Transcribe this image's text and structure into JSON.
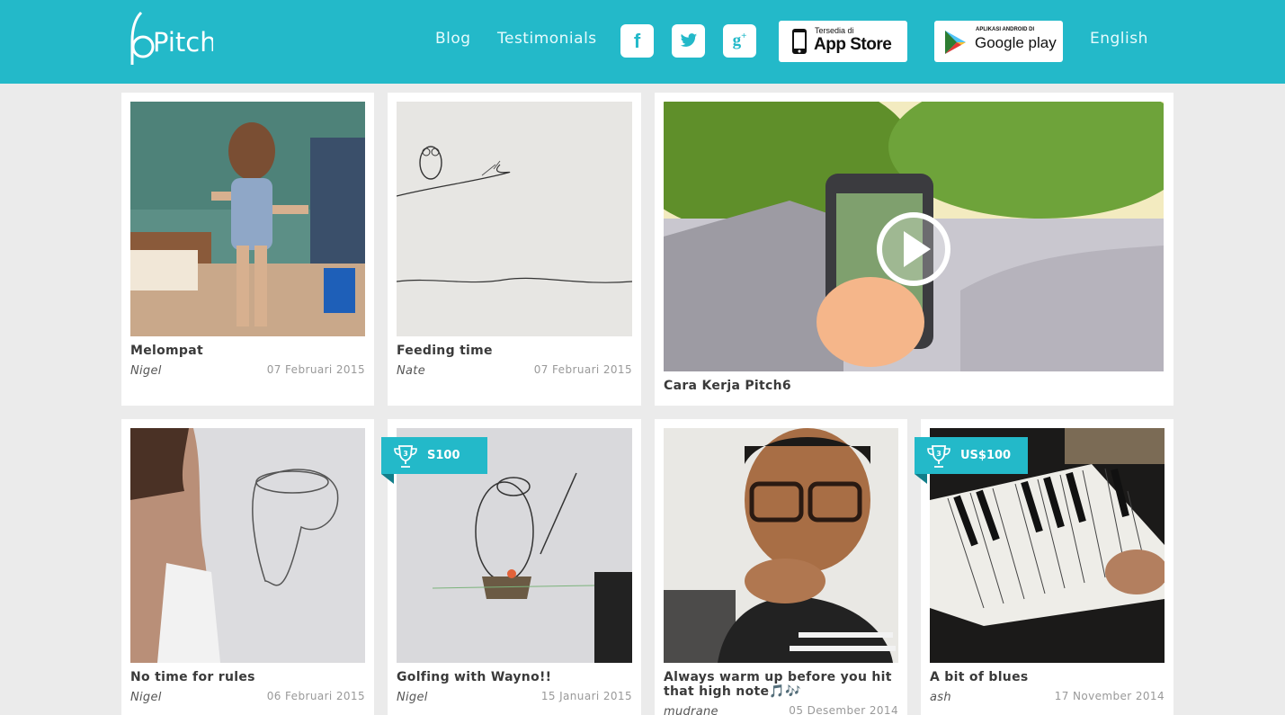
{
  "header": {
    "brand": "Pitch",
    "nav": {
      "blog": "Blog",
      "testimonials": "Testimonials",
      "language": "English"
    },
    "social": {
      "facebook_icon": "facebook-icon",
      "twitter_icon": "twitter-icon",
      "gplus_icon": "google-plus-icon"
    },
    "appstore": {
      "small": "Tersedia di",
      "big": "App Store"
    },
    "googleplay": {
      "small": "APLIKASI ANDROID DI",
      "big": "Google play"
    }
  },
  "colors": {
    "accent": "#23b9c9",
    "background": "#ebebeb",
    "card": "#ffffff"
  },
  "video": {
    "title": "Cara Kerja Pitch6",
    "play_icon": "play-icon"
  },
  "posts": [
    {
      "title": "Melompat",
      "author": "Nigel",
      "date": "07 Februari 2015"
    },
    {
      "title": "Feeding time",
      "author": "Nate",
      "date": "07 Februari 2015"
    },
    {
      "title": "No time for rules",
      "author": "Nigel",
      "date": "06 Februari 2015"
    },
    {
      "title": "Golfing with Wayno!!",
      "author": "Nigel",
      "date": "15 Januari 2015",
      "badge": "S100"
    },
    {
      "title": "Always warm up before you hit that high note🎵🎶",
      "author": "mudrane",
      "date": "05 Desember 2014"
    },
    {
      "title": "A bit of blues",
      "author": "ash",
      "date": "17 November 2014",
      "badge": "US$100"
    }
  ]
}
